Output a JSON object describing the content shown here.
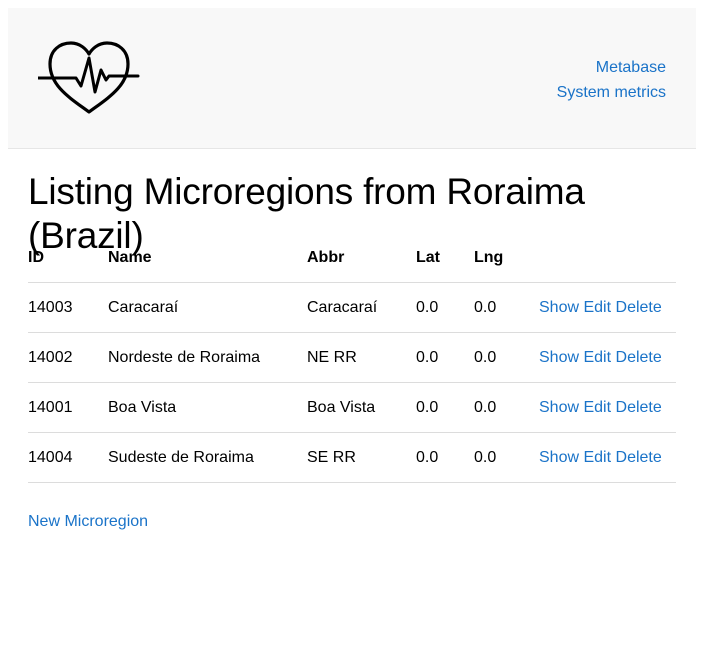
{
  "nav": {
    "metabase_label": "Metabase",
    "system_metrics_label": "System metrics"
  },
  "logo_icon": "heart-pulse-icon",
  "page_title": "Listing Microregions from Roraima (Brazil)",
  "table": {
    "headers": [
      "ID",
      "Name",
      "Abbr",
      "Lat",
      "Lng",
      ""
    ],
    "rows": [
      {
        "id": "14003",
        "name": "Caracaraí",
        "abbr": "Caracaraí",
        "lat": "0.0",
        "lng": "0.0",
        "show": "Show",
        "edit": "Edit",
        "delete": "Delete"
      },
      {
        "id": "14002",
        "name": "Nordeste de Roraima",
        "abbr": "NE RR",
        "lat": "0.0",
        "lng": "0.0",
        "show": "Show",
        "edit": "Edit",
        "delete": "Delete"
      },
      {
        "id": "14001",
        "name": "Boa Vista",
        "abbr": "Boa Vista",
        "lat": "0.0",
        "lng": "0.0",
        "show": "Show",
        "edit": "Edit",
        "delete": "Delete"
      },
      {
        "id": "14004",
        "name": "Sudeste de Roraima",
        "abbr": "SE RR",
        "lat": "0.0",
        "lng": "0.0",
        "show": "Show",
        "edit": "Edit",
        "delete": "Delete"
      }
    ]
  },
  "new_link_label": "New Microregion",
  "colors": {
    "link": "#1a73c8",
    "header_bg": "#f8f8f8"
  }
}
